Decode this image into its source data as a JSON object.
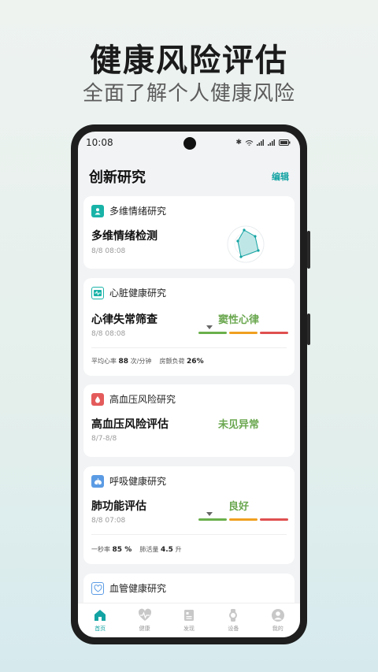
{
  "promo": {
    "title": "健康风险评估",
    "subtitle": "全面了解个人健康风险"
  },
  "statusbar": {
    "time": "10:08",
    "icons": [
      "bluetooth-icon",
      "wifi-icon",
      "signal-icon",
      "signal-icon",
      "battery-icon"
    ]
  },
  "header": {
    "title": "创新研究",
    "edit_label": "编辑"
  },
  "cards": [
    {
      "category": "多维情绪研究",
      "icon": "person-icon",
      "color": "#19b3a8",
      "name": "多维情绪检测",
      "time": "8/8 08:08"
    },
    {
      "category": "心脏健康研究",
      "icon": "heart-report-icon",
      "color": "#19b3a8",
      "name": "心律失常筛查",
      "time": "8/8 08:08",
      "result": "窦性心律",
      "level": 0.12,
      "metrics": [
        {
          "label": "平均心率",
          "value": "88",
          "unit": "次/分钟"
        },
        {
          "label": "房颤负荷",
          "value": "26%",
          "unit": ""
        }
      ]
    },
    {
      "category": "高血压风险研究",
      "icon": "blood-drop-icon",
      "color": "#e45b5b",
      "name": "高血压风险评估",
      "time": "8/7-8/8",
      "result": "未见异常"
    },
    {
      "category": "呼吸健康研究",
      "icon": "lung-icon",
      "color": "#5b9be4",
      "name": "肺功能评估",
      "time": "8/8 07:08",
      "result": "良好",
      "level": 0.12,
      "metrics": [
        {
          "label": "一秒率",
          "value": "85 %",
          "unit": ""
        },
        {
          "label": "肺活量",
          "value": "4.5",
          "unit": "升"
        }
      ]
    },
    {
      "category": "血管健康研究",
      "icon": "vessel-icon",
      "color": "#5b9be4"
    }
  ],
  "colors": {
    "accent": "#14a3a3",
    "normal": "#6aa74f",
    "bar_green": "#6ab04c",
    "bar_orange": "#f0a020",
    "bar_red": "#e05050"
  },
  "tabs": [
    {
      "label": "首页",
      "icon": "home-icon",
      "active": true
    },
    {
      "label": "健康",
      "icon": "heartbeat-icon",
      "active": false
    },
    {
      "label": "发现",
      "icon": "discover-icon",
      "active": false
    },
    {
      "label": "设备",
      "icon": "watch-icon",
      "active": false
    },
    {
      "label": "我的",
      "icon": "profile-icon",
      "active": false
    }
  ]
}
